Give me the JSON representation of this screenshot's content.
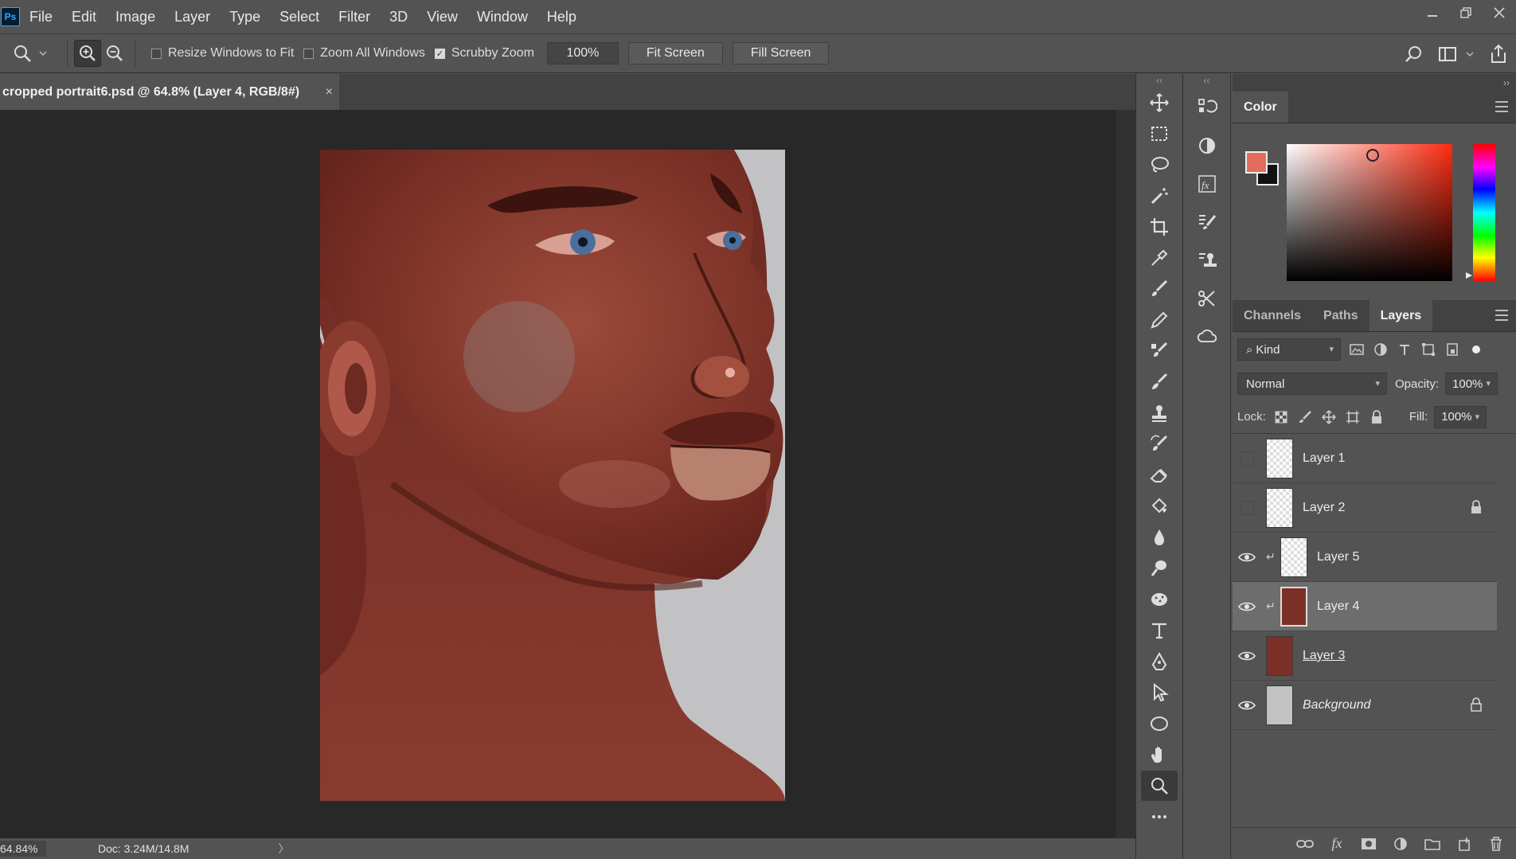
{
  "app": {
    "logo": "Ps",
    "accent": "#31a8ff"
  },
  "menu": [
    "File",
    "Edit",
    "Image",
    "Layer",
    "Type",
    "Select",
    "Filter",
    "3D",
    "View",
    "Window",
    "Help"
  ],
  "options": {
    "resize_windows": {
      "label": "Resize Windows to Fit",
      "checked": false
    },
    "zoom_all": {
      "label": "Zoom All Windows",
      "checked": false
    },
    "scrubby_zoom": {
      "label": "Scrubby Zoom",
      "checked": true
    },
    "zoom_value": "100%",
    "fit_screen": "Fit Screen",
    "fill_screen": "Fill Screen"
  },
  "document": {
    "tab_title": "cropped portrait6.psd @ 64.8% (Layer 4, RGB/8#)",
    "close": "×"
  },
  "status": {
    "zoom": "64.84%",
    "doc": "Doc: 3.24M/14.8M",
    "arrow": "〉"
  },
  "tools": [
    "move-icon",
    "marquee-icon",
    "lasso-icon",
    "magic-wand-icon",
    "crop-icon",
    "eyedropper-icon",
    "brush-icon",
    "pencil-icon",
    "mixer-brush-icon",
    "smudge-brush-icon",
    "stamp-icon",
    "history-brush-icon",
    "eraser-icon",
    "paint-bucket-icon",
    "blur-icon",
    "dodge-icon",
    "sponge-icon",
    "type-icon",
    "pen-icon",
    "path-select-icon",
    "ellipse-icon",
    "hand-icon",
    "zoom-icon",
    "more-icon"
  ],
  "colorpanel": {
    "title": "Color",
    "foreground": "#e36c5f",
    "background": "#111111"
  },
  "layers_panel": {
    "tabs": [
      "Channels",
      "Paths",
      "Layers"
    ],
    "active_tab": "Layers",
    "kind": "Kind",
    "blend_mode": "Normal",
    "opacity_label": "Opacity:",
    "opacity": "100%",
    "lock_label": "Lock:",
    "fill_label": "Fill:",
    "fill": "100%",
    "layers": [
      {
        "name": "Layer 1",
        "visible": false,
        "locked": false,
        "clipped": false,
        "selected": false
      },
      {
        "name": "Layer 2",
        "visible": false,
        "locked": true,
        "clipped": false,
        "selected": false
      },
      {
        "name": "Layer 5",
        "visible": true,
        "locked": false,
        "clipped": true,
        "selected": false
      },
      {
        "name": "Layer 4",
        "visible": true,
        "locked": false,
        "clipped": true,
        "selected": true
      },
      {
        "name": "Layer 3",
        "visible": true,
        "locked": false,
        "clipped": false,
        "selected": false
      },
      {
        "name": "Background",
        "visible": true,
        "locked": true,
        "clipped": false,
        "selected": false
      }
    ]
  }
}
